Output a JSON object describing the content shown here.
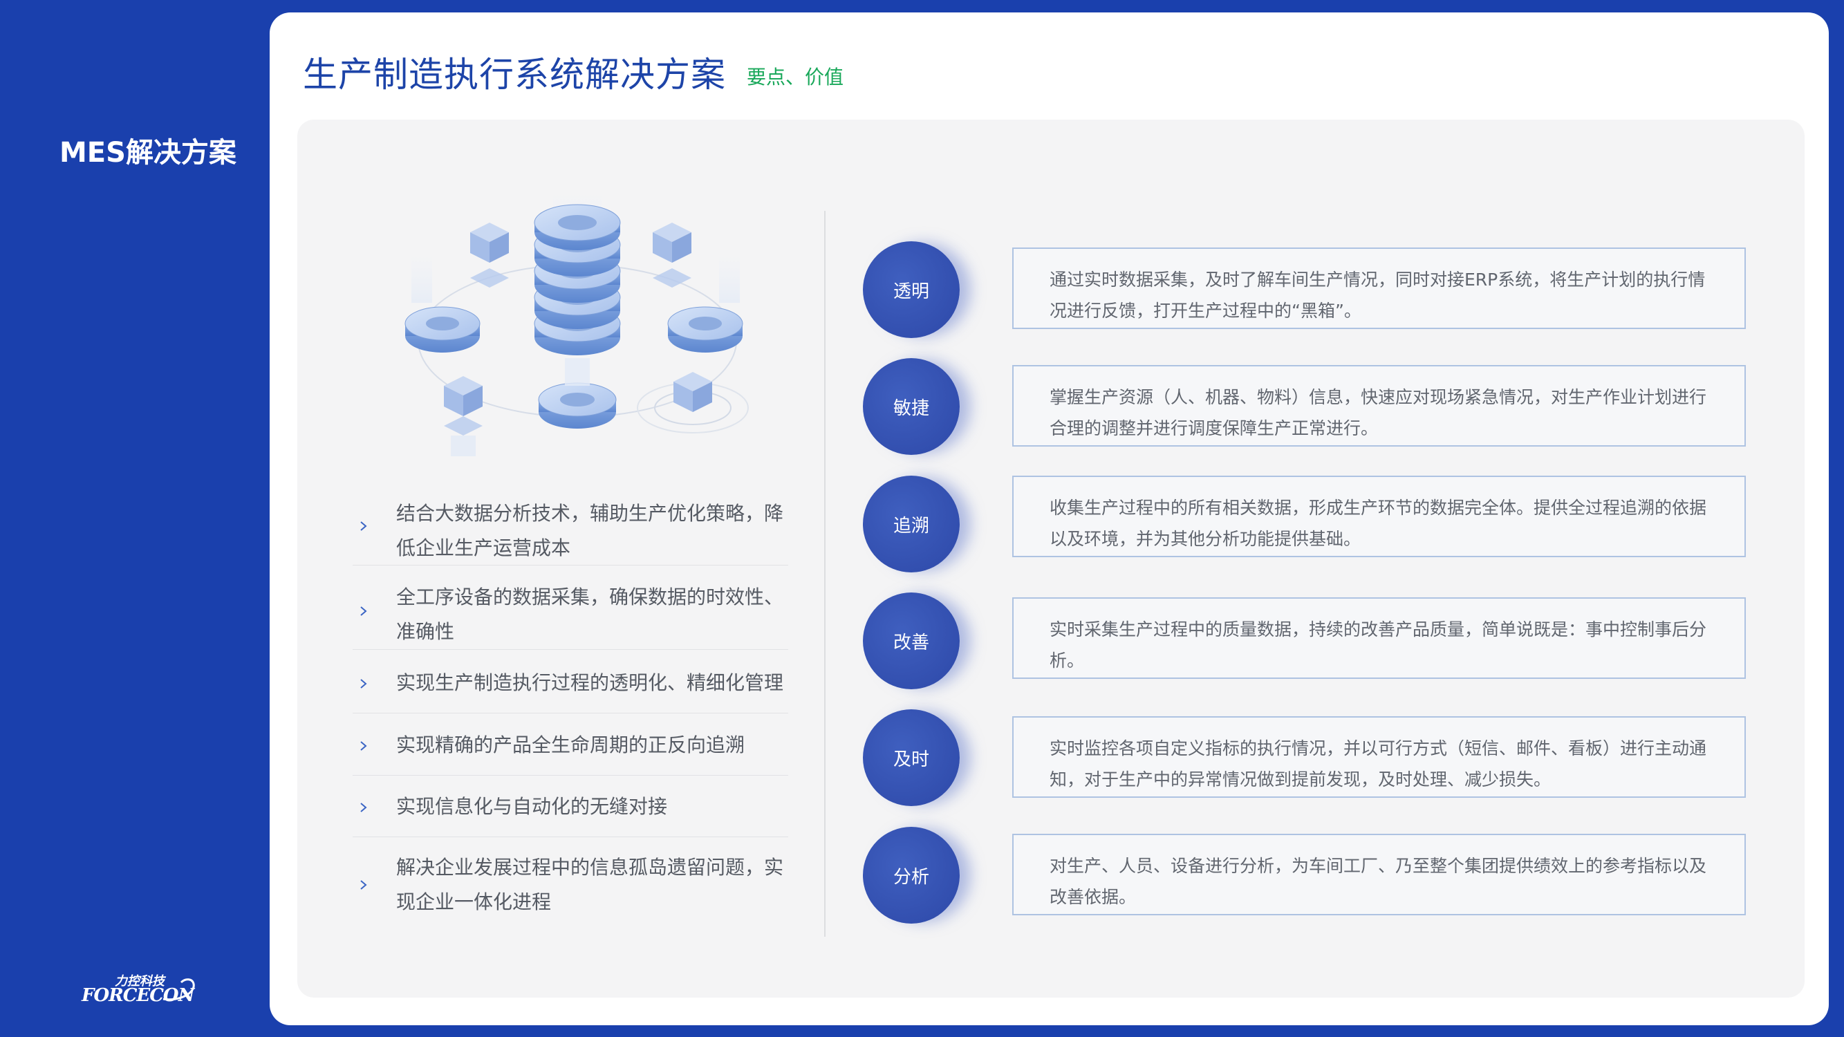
{
  "sidebar": {
    "title": "MES解决方案"
  },
  "logo": {
    "cn": "力控科技",
    "en": "FORCECON"
  },
  "header": {
    "title": "生产制造执行系统解决方案",
    "subtitle": "要点、价值"
  },
  "bullets": [
    {
      "text": "结合大数据分析技术，辅助生产优化策略，降低企业生产运营成本"
    },
    {
      "text": "全工序设备的数据采集，确保数据的时效性、准确性"
    },
    {
      "text": "实现生产制造执行过程的透明化、精细化管理"
    },
    {
      "text": "实现精确的产品全生命周期的正反向追溯"
    },
    {
      "text": "实现信息化与自动化的无缝对接"
    },
    {
      "text": "解决企业发展过程中的信息孤岛遗留问题，实现企业一体化进程"
    }
  ],
  "features": [
    {
      "label": "透明",
      "desc": "通过实时数据采集，及时了解车间生产情况，同时对接ERP系统，将生产计划的执行情况进行反馈，打开生产过程中的“黑箱”。"
    },
    {
      "label": "敏捷",
      "desc": "掌握生产资源（人、机器、物料）信息，快速应对现场紧急情况，对生产作业计划进行合理的调整并进行调度保障生产正常进行。"
    },
    {
      "label": "追溯",
      "desc": "收集生产过程中的所有相关数据，形成生产环节的数据完全体。提供全过程追溯的依据以及环境，并为其他分析功能提供基础。"
    },
    {
      "label": "改善",
      "desc": "实时采集生产过程中的质量数据，持续的改善产品质量，简单说既是：事中控制事后分析。"
    },
    {
      "label": "及时",
      "desc": "实时监控各项自定义指标的执行情况，并以可行方式（短信、邮件、看板）进行主动通知，对于生产中的异常情况做到提前发现，及时处理、减少损失。"
    },
    {
      "label": "分析",
      "desc": "对生产、人员、设备进行分析，为车间工厂、乃至整个集团提供绩效上的参考指标以及改善依据。"
    }
  ]
}
